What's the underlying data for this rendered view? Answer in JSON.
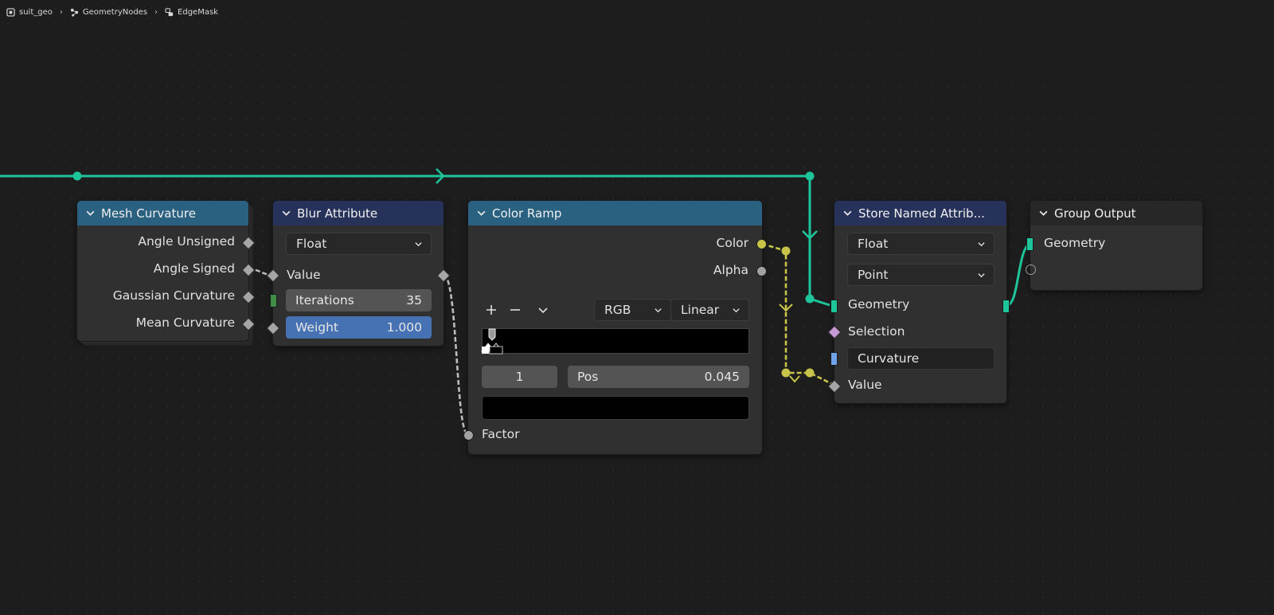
{
  "breadcrumb": {
    "items": [
      {
        "label": "suit_geo",
        "icon": "object-icon"
      },
      {
        "label": "GeometryNodes",
        "icon": "geometry-nodes-icon"
      },
      {
        "label": "EdgeMask",
        "icon": "node-tree-icon"
      }
    ]
  },
  "colors": {
    "geometry_socket": "#1ec59b",
    "float_socket": "#a1a1a1",
    "color_socket": "#c8c44a",
    "int_socket": "#3f8d47",
    "header_input": "#2a6080",
    "header_geometry": "#27325a",
    "active_field": "#4672b4"
  },
  "nodes": {
    "mesh_curvature": {
      "title": "Mesh Curvature",
      "outputs": [
        "Angle Unsigned",
        "Angle Signed",
        "Gaussian Curvature",
        "Mean Curvature"
      ]
    },
    "blur_attribute": {
      "title": "Blur Attribute",
      "data_type": "Float",
      "value_label": "Value",
      "iterations_label": "Iterations",
      "iterations_value": "35",
      "weight_label": "Weight",
      "weight_value": "1.000"
    },
    "color_ramp": {
      "title": "Color Ramp",
      "outputs": [
        "Color",
        "Alpha"
      ],
      "color_mode": "RGB",
      "interpolation": "Linear",
      "stop_index": "1",
      "pos_label": "Pos",
      "pos_value": "0.045",
      "factor_label": "Factor",
      "add_icon": "plus-icon",
      "remove_icon": "minus-icon",
      "menu_icon": "chevron-down-icon"
    },
    "store_named_attribute": {
      "title": "Store Named Attrib...",
      "data_type": "Float",
      "domain": "Point",
      "geometry_label": "Geometry",
      "selection_label": "Selection",
      "name_value": "Curvature",
      "value_label": "Value"
    },
    "group_output": {
      "title": "Group Output",
      "geometry_label": "Geometry"
    }
  }
}
